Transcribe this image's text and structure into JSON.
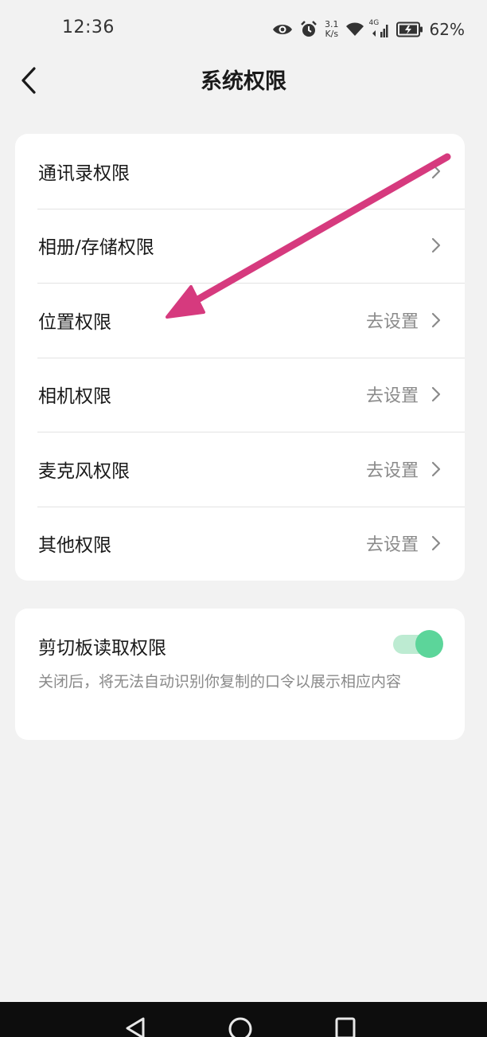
{
  "status_bar": {
    "time": "12:36",
    "net_speed_value": "3.1",
    "net_speed_unit": "K/s",
    "network_type": "4G",
    "battery": "62%",
    "icons": [
      "eye-icon",
      "alarm-icon",
      "wifi-icon",
      "signal-icon",
      "battery-icon"
    ]
  },
  "header": {
    "title": "系统权限",
    "back_icon": "chevron-left-icon"
  },
  "permissions": {
    "items": [
      {
        "label": "通讯录权限",
        "value": ""
      },
      {
        "label": "相册/存储权限",
        "value": ""
      },
      {
        "label": "位置权限",
        "value": "去设置"
      },
      {
        "label": "相机权限",
        "value": "去设置"
      },
      {
        "label": "麦克风权限",
        "value": "去设置"
      },
      {
        "label": "其他权限",
        "value": "去设置"
      }
    ]
  },
  "clipboard": {
    "title": "剪切板读取权限",
    "description": "关闭后，将无法自动识别你复制的口令以展示相应内容",
    "enabled": true
  },
  "annotation": {
    "arrow_color": "#d63a7e",
    "points_to": "位置权限"
  },
  "system_nav": {
    "icons": [
      "back-triangle-icon",
      "home-circle-icon",
      "recents-square-icon"
    ]
  },
  "colors": {
    "background": "#f2f2f2",
    "card": "#ffffff",
    "toggle_on": "#5cd59a",
    "secondary_text": "#8a8a8a"
  }
}
